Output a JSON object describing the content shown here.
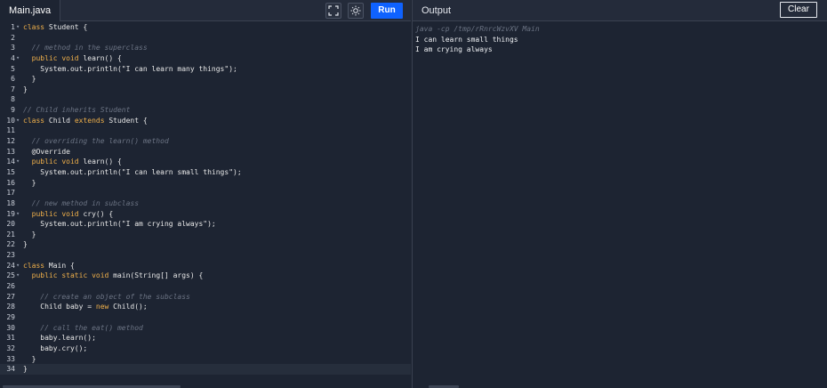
{
  "editor": {
    "tab_label": "Main.java",
    "run_label": "Run",
    "fullscreen_icon": "fullscreen-icon",
    "theme_icon": "sun-icon",
    "lines": [
      {
        "n": "1",
        "fold": true,
        "tokens": [
          {
            "t": "class",
            "c": "kw"
          },
          {
            "t": " Student {"
          }
        ]
      },
      {
        "n": "2",
        "tokens": []
      },
      {
        "n": "3",
        "tokens": [
          {
            "t": "  // method in the superclass",
            "c": "cm"
          }
        ]
      },
      {
        "n": "4",
        "fold": true,
        "tokens": [
          {
            "t": "  "
          },
          {
            "t": "public void",
            "c": "kw"
          },
          {
            "t": " learn() {"
          }
        ]
      },
      {
        "n": "5",
        "tokens": [
          {
            "t": "    System.out.println("
          },
          {
            "t": "\"I can learn many things\"",
            "c": "st"
          },
          {
            "t": ");"
          }
        ]
      },
      {
        "n": "6",
        "tokens": [
          {
            "t": "  }"
          }
        ]
      },
      {
        "n": "7",
        "tokens": [
          {
            "t": "}"
          }
        ]
      },
      {
        "n": "8",
        "tokens": []
      },
      {
        "n": "9",
        "tokens": [
          {
            "t": "// Child inherits Student",
            "c": "cm"
          }
        ]
      },
      {
        "n": "10",
        "fold": true,
        "tokens": [
          {
            "t": "class",
            "c": "kw"
          },
          {
            "t": " Child "
          },
          {
            "t": "extends",
            "c": "kw"
          },
          {
            "t": " Student {"
          }
        ]
      },
      {
        "n": "11",
        "tokens": []
      },
      {
        "n": "12",
        "tokens": [
          {
            "t": "  // overriding the learn() method",
            "c": "cm"
          }
        ]
      },
      {
        "n": "13",
        "tokens": [
          {
            "t": "  @Override"
          }
        ]
      },
      {
        "n": "14",
        "fold": true,
        "tokens": [
          {
            "t": "  "
          },
          {
            "t": "public void",
            "c": "kw"
          },
          {
            "t": " learn() {"
          }
        ]
      },
      {
        "n": "15",
        "tokens": [
          {
            "t": "    System.out.println("
          },
          {
            "t": "\"I can learn small things\"",
            "c": "st"
          },
          {
            "t": ");"
          }
        ]
      },
      {
        "n": "16",
        "tokens": [
          {
            "t": "  }"
          }
        ]
      },
      {
        "n": "17",
        "tokens": []
      },
      {
        "n": "18",
        "tokens": [
          {
            "t": "  // new method in subclass",
            "c": "cm"
          }
        ]
      },
      {
        "n": "19",
        "fold": true,
        "tokens": [
          {
            "t": "  "
          },
          {
            "t": "public void",
            "c": "kw"
          },
          {
            "t": " cry() {"
          }
        ]
      },
      {
        "n": "20",
        "tokens": [
          {
            "t": "    System.out.println("
          },
          {
            "t": "\"I am crying always\"",
            "c": "st"
          },
          {
            "t": ");"
          }
        ]
      },
      {
        "n": "21",
        "tokens": [
          {
            "t": "  }"
          }
        ]
      },
      {
        "n": "22",
        "tokens": [
          {
            "t": "}"
          }
        ]
      },
      {
        "n": "23",
        "tokens": []
      },
      {
        "n": "24",
        "fold": true,
        "tokens": [
          {
            "t": "class",
            "c": "kw"
          },
          {
            "t": " Main {"
          }
        ]
      },
      {
        "n": "25",
        "fold": true,
        "tokens": [
          {
            "t": "  "
          },
          {
            "t": "public static void",
            "c": "kw"
          },
          {
            "t": " main(String[] args) {"
          }
        ]
      },
      {
        "n": "26",
        "tokens": []
      },
      {
        "n": "27",
        "tokens": [
          {
            "t": "    // create an object of the subclass",
            "c": "cm"
          }
        ]
      },
      {
        "n": "28",
        "tokens": [
          {
            "t": "    Child baby = "
          },
          {
            "t": "new",
            "c": "kw"
          },
          {
            "t": " Child();"
          }
        ]
      },
      {
        "n": "29",
        "tokens": []
      },
      {
        "n": "30",
        "tokens": [
          {
            "t": "    // call the eat() method",
            "c": "cm"
          }
        ]
      },
      {
        "n": "31",
        "tokens": [
          {
            "t": "    baby.learn();"
          }
        ]
      },
      {
        "n": "32",
        "tokens": [
          {
            "t": "    baby.cry();"
          }
        ]
      },
      {
        "n": "33",
        "tokens": [
          {
            "t": "  }"
          }
        ]
      },
      {
        "n": "34",
        "active": true,
        "tokens": [
          {
            "t": "}"
          }
        ]
      }
    ]
  },
  "output": {
    "title": "Output",
    "clear_label": "Clear",
    "command": "java -cp /tmp/rRnrcWzvXV Main",
    "lines": [
      "I can learn small things",
      "I am crying always"
    ]
  }
}
